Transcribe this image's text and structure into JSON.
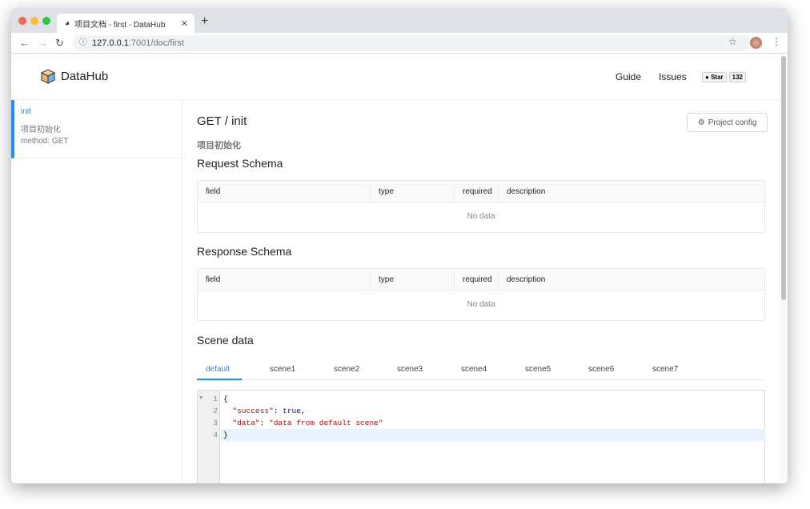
{
  "browser": {
    "tab_title": "项目文档 - first - DataHub",
    "url_host": "127.0.0.1",
    "url_path": ":7001/doc/first"
  },
  "header": {
    "logo": "DataHub",
    "nav": [
      "Guide",
      "Issues"
    ],
    "star_label": "Star",
    "star_count": "132"
  },
  "sidebar": {
    "items": [
      {
        "name": "init",
        "desc": "项目初始化",
        "method": "method: GET"
      }
    ]
  },
  "main": {
    "title": "GET / init",
    "description": "项目初始化",
    "config_button": "Project config",
    "request_title": "Request Schema",
    "response_title": "Response Schema",
    "columns": [
      "field",
      "type",
      "required",
      "description"
    ],
    "empty": "No data",
    "scene_title": "Scene data",
    "scene_tabs": [
      "default",
      "scene1",
      "scene2",
      "scene3",
      "scene4",
      "scene5",
      "scene6",
      "scene7"
    ],
    "code_lines": [
      {
        "n": "1",
        "text": "{"
      },
      {
        "n": "2",
        "key": "\"success\"",
        "sep": ": ",
        "val": "true",
        "end": ","
      },
      {
        "n": "3",
        "key": "\"data\"",
        "sep": ": ",
        "val": "\"data from default scene\"",
        "end": ""
      },
      {
        "n": "4",
        "text": "}"
      }
    ]
  }
}
